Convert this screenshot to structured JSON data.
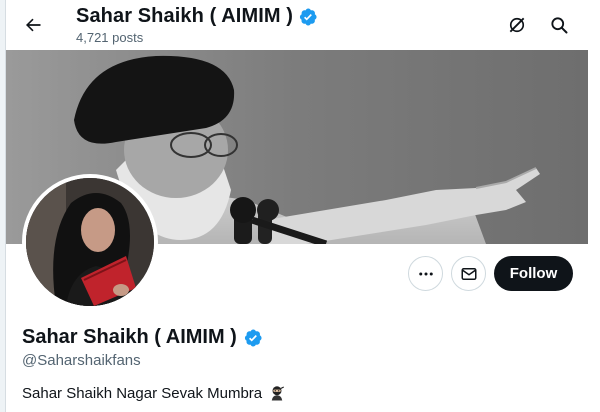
{
  "header": {
    "title": "Sahar Shaikh ( AIMIM )",
    "posts_count": "4,721 posts"
  },
  "profile": {
    "display_name": "Sahar Shaikh ( AIMIM )",
    "handle": "@Saharshaikfans",
    "bio": "Sahar Shaikh Nagar Sevak Mumbra",
    "verified": true
  },
  "actions": {
    "follow_label": "Follow"
  },
  "icons": {
    "back": "arrow-left-icon",
    "grok": "grok-icon",
    "search": "search-icon",
    "more": "ellipsis-icon",
    "message": "envelope-icon",
    "verified": "verified-badge-icon",
    "bio_emoji": "ninja-emoji"
  },
  "colors": {
    "verified_blue": "#1d9bf0",
    "follow_bg": "#0f1419",
    "muted_text": "#536471"
  }
}
